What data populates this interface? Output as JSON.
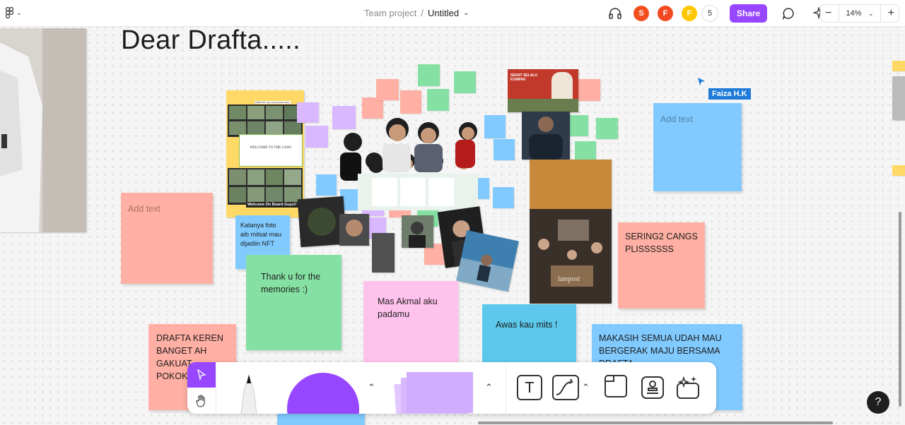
{
  "header": {
    "menu_icon": "figma-logo-icon",
    "project": "Team project",
    "separator": "/",
    "file_name": "Untitled",
    "avatars": [
      {
        "letter": "S",
        "color": "#f24e1e"
      },
      {
        "letter": "F",
        "color": "#f24822"
      },
      {
        "letter": "F",
        "color": "#ffc700"
      }
    ],
    "collaborator_count": "5",
    "share_label": "Share",
    "zoom_value": "14%",
    "zoom_minus": "−",
    "zoom_plus": "+"
  },
  "canvas": {
    "title": "Dear Drafta.....",
    "cursor_user": "Faiza H.K",
    "stickies": {
      "add_text_left": "Add text",
      "add_text_right": "Add text",
      "nft": "Katanya foto aib mitsal mau dijadiin NFT",
      "memories": "Thank u for the memories :)",
      "akmal": "Mas Akmal aku padamu",
      "awas": "Awas kau mits !",
      "sering": "SERING2 CANGS PLISSSSSS",
      "keren": "DRAFTA KEREN BANGET AH GAKUAT POKOKNYA",
      "makasih": "MAKASIH SEMUA UDAH MAU BERGERAK MAJU BERSAMA DRAFTA"
    },
    "collage": {
      "zoom_header": "LATEPOST! tapi orang tambah rame :)",
      "welcome": "Welcome On Board Guys!!",
      "gang_title": "WELCOME TO THE GANG",
      "banner": "SEHAT SELALU KOMPAK",
      "latepost": "latepost"
    }
  },
  "toolbar": {
    "tools": [
      "move-tool",
      "hand-tool",
      "marker-tool",
      "shape-tool",
      "sticky-tool",
      "text-tool",
      "connector-tool",
      "section-tool",
      "stamp-tool",
      "actions-tool"
    ]
  },
  "help_label": "?",
  "colors": {
    "accent": "#9747ff",
    "sticky_pink": "#ffafa3",
    "sticky_green": "#85e0a3",
    "sticky_blue": "#80caff",
    "sticky_purple": "#d9b8ff",
    "sticky_magenta": "#ffc2ec",
    "sticky_orange": "#ffd966"
  }
}
